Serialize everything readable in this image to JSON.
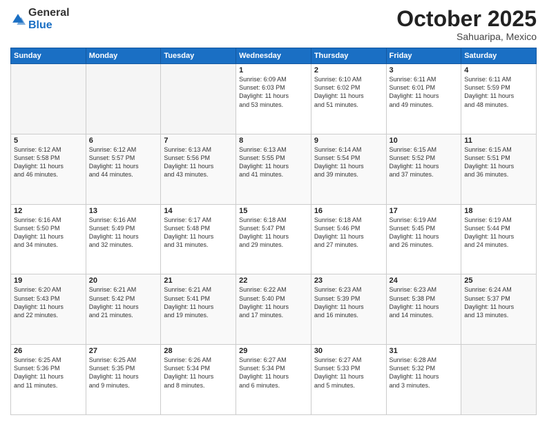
{
  "logo": {
    "general": "General",
    "blue": "Blue"
  },
  "header": {
    "month": "October 2025",
    "location": "Sahuaripa, Mexico"
  },
  "weekdays": [
    "Sunday",
    "Monday",
    "Tuesday",
    "Wednesday",
    "Thursday",
    "Friday",
    "Saturday"
  ],
  "weeks": [
    [
      {
        "day": "",
        "info": ""
      },
      {
        "day": "",
        "info": ""
      },
      {
        "day": "",
        "info": ""
      },
      {
        "day": "1",
        "info": "Sunrise: 6:09 AM\nSunset: 6:03 PM\nDaylight: 11 hours\nand 53 minutes."
      },
      {
        "day": "2",
        "info": "Sunrise: 6:10 AM\nSunset: 6:02 PM\nDaylight: 11 hours\nand 51 minutes."
      },
      {
        "day": "3",
        "info": "Sunrise: 6:11 AM\nSunset: 6:01 PM\nDaylight: 11 hours\nand 49 minutes."
      },
      {
        "day": "4",
        "info": "Sunrise: 6:11 AM\nSunset: 5:59 PM\nDaylight: 11 hours\nand 48 minutes."
      }
    ],
    [
      {
        "day": "5",
        "info": "Sunrise: 6:12 AM\nSunset: 5:58 PM\nDaylight: 11 hours\nand 46 minutes."
      },
      {
        "day": "6",
        "info": "Sunrise: 6:12 AM\nSunset: 5:57 PM\nDaylight: 11 hours\nand 44 minutes."
      },
      {
        "day": "7",
        "info": "Sunrise: 6:13 AM\nSunset: 5:56 PM\nDaylight: 11 hours\nand 43 minutes."
      },
      {
        "day": "8",
        "info": "Sunrise: 6:13 AM\nSunset: 5:55 PM\nDaylight: 11 hours\nand 41 minutes."
      },
      {
        "day": "9",
        "info": "Sunrise: 6:14 AM\nSunset: 5:54 PM\nDaylight: 11 hours\nand 39 minutes."
      },
      {
        "day": "10",
        "info": "Sunrise: 6:15 AM\nSunset: 5:52 PM\nDaylight: 11 hours\nand 37 minutes."
      },
      {
        "day": "11",
        "info": "Sunrise: 6:15 AM\nSunset: 5:51 PM\nDaylight: 11 hours\nand 36 minutes."
      }
    ],
    [
      {
        "day": "12",
        "info": "Sunrise: 6:16 AM\nSunset: 5:50 PM\nDaylight: 11 hours\nand 34 minutes."
      },
      {
        "day": "13",
        "info": "Sunrise: 6:16 AM\nSunset: 5:49 PM\nDaylight: 11 hours\nand 32 minutes."
      },
      {
        "day": "14",
        "info": "Sunrise: 6:17 AM\nSunset: 5:48 PM\nDaylight: 11 hours\nand 31 minutes."
      },
      {
        "day": "15",
        "info": "Sunrise: 6:18 AM\nSunset: 5:47 PM\nDaylight: 11 hours\nand 29 minutes."
      },
      {
        "day": "16",
        "info": "Sunrise: 6:18 AM\nSunset: 5:46 PM\nDaylight: 11 hours\nand 27 minutes."
      },
      {
        "day": "17",
        "info": "Sunrise: 6:19 AM\nSunset: 5:45 PM\nDaylight: 11 hours\nand 26 minutes."
      },
      {
        "day": "18",
        "info": "Sunrise: 6:19 AM\nSunset: 5:44 PM\nDaylight: 11 hours\nand 24 minutes."
      }
    ],
    [
      {
        "day": "19",
        "info": "Sunrise: 6:20 AM\nSunset: 5:43 PM\nDaylight: 11 hours\nand 22 minutes."
      },
      {
        "day": "20",
        "info": "Sunrise: 6:21 AM\nSunset: 5:42 PM\nDaylight: 11 hours\nand 21 minutes."
      },
      {
        "day": "21",
        "info": "Sunrise: 6:21 AM\nSunset: 5:41 PM\nDaylight: 11 hours\nand 19 minutes."
      },
      {
        "day": "22",
        "info": "Sunrise: 6:22 AM\nSunset: 5:40 PM\nDaylight: 11 hours\nand 17 minutes."
      },
      {
        "day": "23",
        "info": "Sunrise: 6:23 AM\nSunset: 5:39 PM\nDaylight: 11 hours\nand 16 minutes."
      },
      {
        "day": "24",
        "info": "Sunrise: 6:23 AM\nSunset: 5:38 PM\nDaylight: 11 hours\nand 14 minutes."
      },
      {
        "day": "25",
        "info": "Sunrise: 6:24 AM\nSunset: 5:37 PM\nDaylight: 11 hours\nand 13 minutes."
      }
    ],
    [
      {
        "day": "26",
        "info": "Sunrise: 6:25 AM\nSunset: 5:36 PM\nDaylight: 11 hours\nand 11 minutes."
      },
      {
        "day": "27",
        "info": "Sunrise: 6:25 AM\nSunset: 5:35 PM\nDaylight: 11 hours\nand 9 minutes."
      },
      {
        "day": "28",
        "info": "Sunrise: 6:26 AM\nSunset: 5:34 PM\nDaylight: 11 hours\nand 8 minutes."
      },
      {
        "day": "29",
        "info": "Sunrise: 6:27 AM\nSunset: 5:34 PM\nDaylight: 11 hours\nand 6 minutes."
      },
      {
        "day": "30",
        "info": "Sunrise: 6:27 AM\nSunset: 5:33 PM\nDaylight: 11 hours\nand 5 minutes."
      },
      {
        "day": "31",
        "info": "Sunrise: 6:28 AM\nSunset: 5:32 PM\nDaylight: 11 hours\nand 3 minutes."
      },
      {
        "day": "",
        "info": ""
      }
    ]
  ]
}
